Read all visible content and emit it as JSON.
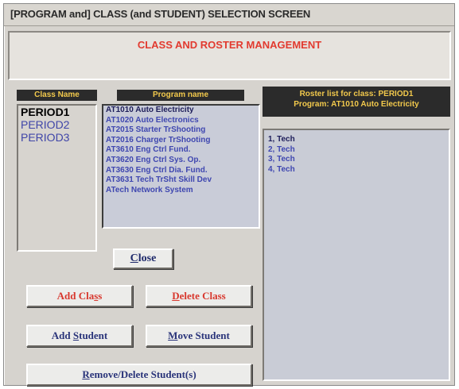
{
  "window": {
    "title": "[PROGRAM and] CLASS (and STUDENT) SELECTION SCREEN"
  },
  "header": {
    "heading": "CLASS AND ROSTER MANAGEMENT"
  },
  "class_list": {
    "header": "Class Name",
    "items": [
      "PERIOD1",
      "PERIOD2",
      "PERIOD3"
    ],
    "selected_index": 0
  },
  "program_list": {
    "header": "Program name",
    "items": [
      "AT1010 Auto Electricity",
      "AT1020 Auto Electronics",
      "AT2015 Starter TrShooting",
      "AT2016 Charger TrShooting",
      "AT3610 Eng Ctrl Fund.",
      "AT3620 Eng Ctrl Sys. Op.",
      "AT3630 Eng Ctrl Dia. Fund.",
      "AT3631 Tech TrSht Skill Dev",
      "ATech Network System"
    ],
    "selected_index": 0
  },
  "roster": {
    "header_line1": "Roster list for class: PERIOD1",
    "header_line2": "Program: AT1010 Auto Electricity",
    "items": [
      "1, Tech",
      "2, Tech",
      "3, Tech",
      "4, Tech"
    ],
    "selected_index": 0
  },
  "buttons": {
    "close": {
      "pre": "",
      "accel": "C",
      "post": "lose"
    },
    "add_class": {
      "pre": "Add Cla",
      "accel": "s",
      "post": "s"
    },
    "delete_class": {
      "pre": "",
      "accel": "D",
      "post": "elete Class"
    },
    "add_student": {
      "pre": "Add ",
      "accel": "S",
      "post": "tudent"
    },
    "move_student": {
      "pre": "",
      "accel": "M",
      "post": "ove Student"
    },
    "remove_student": {
      "pre": "",
      "accel": "R",
      "post": "emove/Delete Student(s)"
    }
  },
  "colors": {
    "window_bg": "#d6d3ce",
    "heading_red": "#e23a2f",
    "column_header_bg": "#2b2b2b",
    "column_header_text": "#f2c94c",
    "list_item_blue": "#3f47b0"
  }
}
